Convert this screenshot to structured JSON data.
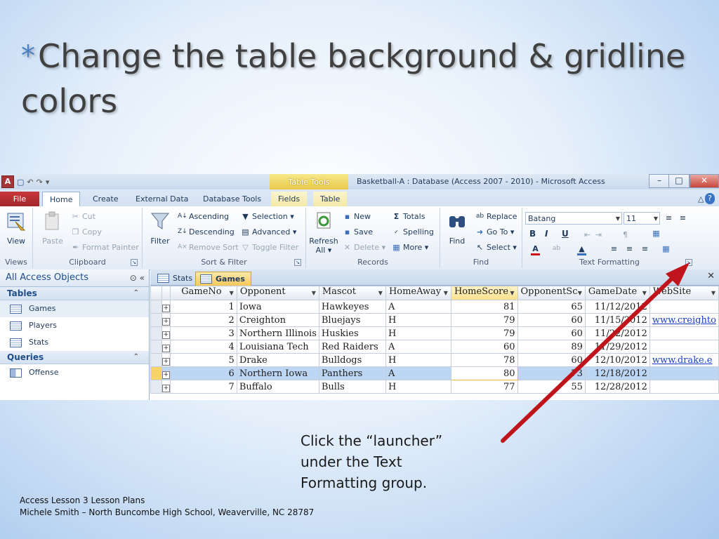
{
  "slide": {
    "bullet": "*",
    "title": "Change the table background & gridline colors",
    "callout": "Click the “launcher” under the Text Formatting group.",
    "footer_line1": "Access Lesson 3 Lesson Plans",
    "footer_line2": "Michele Smith – North Buncombe High School, Weaverville, NC  28787",
    "arrow_color": "#c0141c"
  },
  "app": {
    "window_title": "Basketball-A : Database (Access 2007 - 2010)  -  Microsoft Access",
    "context_title": "Table Tools",
    "app_icon": "A",
    "qat_glyphs": [
      "▾",
      "↶",
      "↷",
      "▾"
    ],
    "window_controls": [
      "–",
      "□",
      "✕"
    ],
    "tabs": [
      "File",
      "Home",
      "Create",
      "External Data",
      "Database Tools",
      "Fields",
      "Table"
    ],
    "help_glyphs": [
      "△",
      "?"
    ]
  },
  "ribbon": {
    "views": {
      "name": "Views",
      "view": "View"
    },
    "clipboard": {
      "name": "Clipboard",
      "paste": "Paste",
      "cut": "Cut",
      "copy": "Copy",
      "format_painter": "Format Painter"
    },
    "sort_filter": {
      "name": "Sort & Filter",
      "filter": "Filter",
      "ascending": "Ascending",
      "descending": "Descending",
      "remove_sort": "Remove Sort",
      "selection": "Selection ▾",
      "advanced": "Advanced ▾",
      "toggle_filter": "Toggle Filter"
    },
    "records": {
      "name": "Records",
      "refresh": "Refresh",
      "refresh_all": "All ▾",
      "new": "New",
      "save": "Save",
      "delete": "Delete ▾",
      "totals": "Totals",
      "spelling": "Spelling",
      "more": "More ▾"
    },
    "find": {
      "name": "Find",
      "find": "Find",
      "replace": "Replace",
      "goto": "Go To ▾",
      "select": "Select ▾"
    },
    "text_formatting": {
      "name": "Text Formatting",
      "font": "Batang",
      "size": "11",
      "bold": "B",
      "italic": "I",
      "underline": "U"
    }
  },
  "nav": {
    "header": "All Access Objects",
    "tables_label": "Tables",
    "tables": [
      "Games",
      "Players",
      "Stats"
    ],
    "queries_label": "Queries",
    "queries": [
      "Offense"
    ]
  },
  "doc": {
    "tabs": [
      "Stats",
      "Games"
    ],
    "columns": [
      "GameNo",
      "Opponent",
      "Mascot",
      "HomeAway",
      "HomeScore",
      "OpponentSc",
      "GameDate",
      "WebSite"
    ],
    "rows": [
      [
        "1",
        "Iowa",
        "Hawkeyes",
        "A",
        "81",
        "65",
        "11/12/2012",
        ""
      ],
      [
        "2",
        "Creighton",
        "Bluejays",
        "H",
        "79",
        "60",
        "11/15/2012",
        "www.creighto"
      ],
      [
        "3",
        "Northern Illinois",
        "Huskies",
        "H",
        "79",
        "60",
        "11/22/2012",
        ""
      ],
      [
        "4",
        "Louisiana Tech",
        "Red Raiders",
        "A",
        "60",
        "89",
        "11/29/2012",
        ""
      ],
      [
        "5",
        "Drake",
        "Bulldogs",
        "H",
        "78",
        "60",
        "12/10/2012",
        "www.drake.e"
      ],
      [
        "6",
        "Northern Iowa",
        "Panthers",
        "A",
        "80",
        "73",
        "12/18/2012",
        ""
      ],
      [
        "7",
        "Buffalo",
        "Bulls",
        "H",
        "77",
        "55",
        "12/28/2012",
        ""
      ]
    ],
    "selected_row": 6
  },
  "colors": {
    "file_tab": "#b02e32",
    "context_tab": "#f0d35a",
    "link": "#1a3fc4",
    "selected_row": "#bcd6f3"
  }
}
